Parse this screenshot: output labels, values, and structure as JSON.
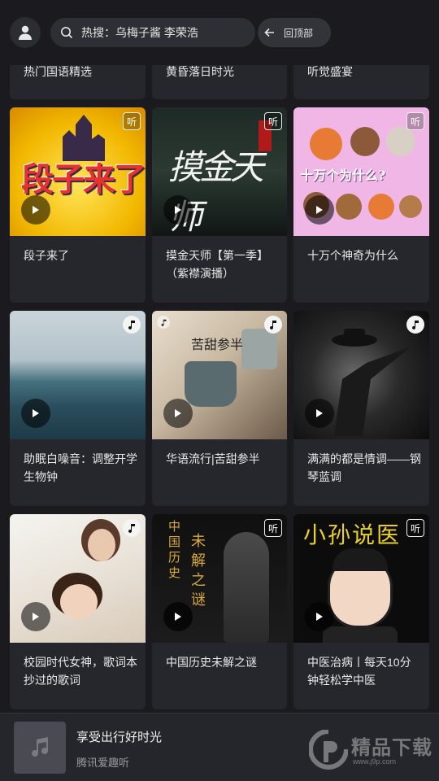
{
  "search": {
    "text": "热搜：乌梅子酱 李荣浩"
  },
  "back_top": {
    "label": "回顶部"
  },
  "partial_row": [
    "热门国语精选",
    "黄昏落日时光",
    "听觉盛宴"
  ],
  "cards": [
    {
      "title": "段子来了",
      "badge": "听",
      "cover_text": "段子来了"
    },
    {
      "title": "摸金天师【第一季】（紫襟演播）",
      "badge": "听",
      "cover_text": "摸金天师"
    },
    {
      "title": "十万个神奇为什么",
      "badge": "听",
      "cover_text": "十万个为什么?"
    },
    {
      "title": "助眠白噪音：调整开学生物钟",
      "badge": "note"
    },
    {
      "title": "华语流行|苦甜参半",
      "badge": "note",
      "cover_text": "苦甜参半"
    },
    {
      "title": "满满的都是情调——钢琴蓝调",
      "badge": "note"
    },
    {
      "title": "校园时代女神，歌词本抄过的歌词",
      "badge": "note"
    },
    {
      "title": "中国历史未解之谜",
      "badge": "听",
      "cover_text_a": "中国历史",
      "cover_text_b": "未解之谜"
    },
    {
      "title": "中医治病丨每天10分钟轻松学中医",
      "badge": "听",
      "cover_text": "小孙说医"
    }
  ],
  "player": {
    "title": "享受出行好时光",
    "subtitle": "腾讯爱趣听"
  },
  "watermark": {
    "text": "精品下载",
    "url": "www.j9p.com"
  }
}
